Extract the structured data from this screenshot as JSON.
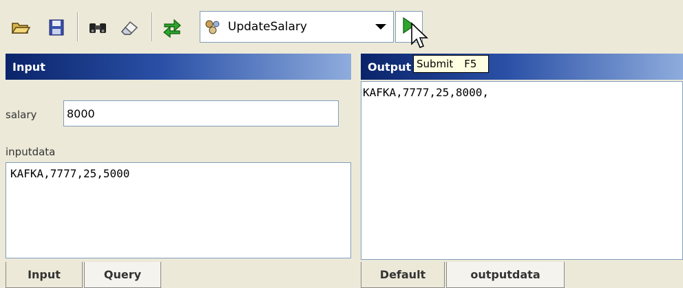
{
  "toolbar": {
    "operation_selected": "UpdateSalary",
    "icons": [
      "open-folder-icon",
      "save-disk-icon",
      "binoculars-icon",
      "eraser-icon",
      "refresh-arrows-icon",
      "operation-icon",
      "dropdown-arrow-icon",
      "run-play-icon"
    ],
    "tooltip_label": "Submit",
    "tooltip_shortcut": "F5"
  },
  "input_panel": {
    "title": "Input",
    "salary_label": "salary",
    "salary_value": "8000",
    "inputdata_label": "inputdata",
    "inputdata_value": "KAFKA,7777,25,5000",
    "tabs": [
      "Input",
      "Query"
    ]
  },
  "output_panel": {
    "title": "Output",
    "output_value": "KAFKA,7777,25,8000,",
    "tabs": [
      "Default",
      "outputdata"
    ]
  },
  "colors": {
    "toolbar_bg": "#ece9d8",
    "header_dark": "#0a246a",
    "header_light": "#8eacdd",
    "border": "#7f9db9",
    "tooltip_bg": "#ffffe1",
    "run_green": "#2fa52f"
  }
}
